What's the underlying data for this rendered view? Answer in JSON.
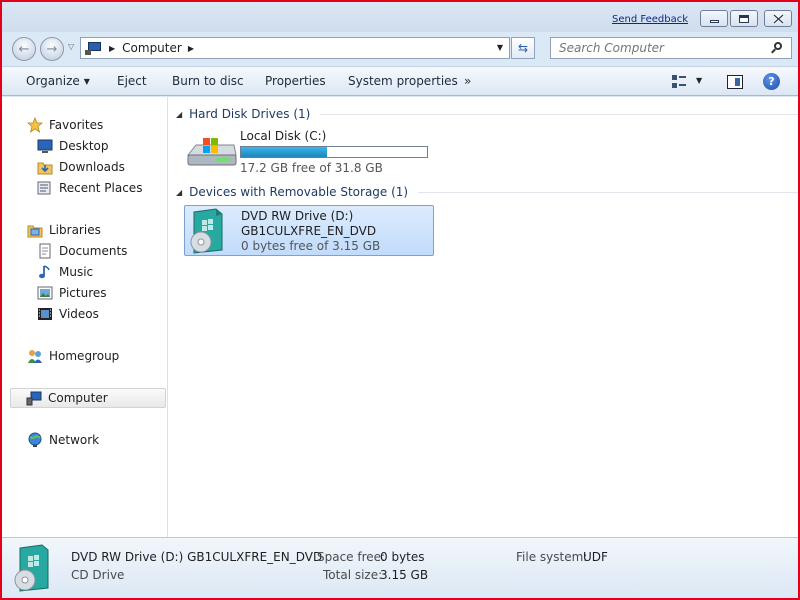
{
  "window": {
    "send_feedback": "Send Feedback"
  },
  "address": {
    "location": "Computer",
    "search_placeholder": "Search Computer"
  },
  "toolbar": {
    "organize": "Organize",
    "eject": "Eject",
    "burn": "Burn to disc",
    "properties": "Properties",
    "system_properties": "System properties",
    "more": "»"
  },
  "sidebar": {
    "favorites": {
      "label": "Favorites",
      "items": [
        "Desktop",
        "Downloads",
        "Recent Places"
      ]
    },
    "libraries": {
      "label": "Libraries",
      "items": [
        "Documents",
        "Music",
        "Pictures",
        "Videos"
      ]
    },
    "homegroup": "Homegroup",
    "computer": "Computer",
    "network": "Network"
  },
  "groups": [
    {
      "header": "Hard Disk Drives (1)",
      "drive": {
        "name": "Local Disk (C:)",
        "free_text": "17.2 GB free of 31.8 GB",
        "used_fraction": 0.46
      }
    },
    {
      "header": "Devices with Removable Storage (1)",
      "drive": {
        "name": "DVD RW Drive (D:)",
        "label": "GB1CULXFRE_EN_DVD",
        "free_text": "0 bytes free of 3.15 GB"
      }
    }
  ],
  "details": {
    "title": "DVD RW Drive (D:) GB1CULXFRE_EN_DVD",
    "type": "CD Drive",
    "space_free_label": "Space free:",
    "space_free": "0 bytes",
    "total_size_label": "Total size:",
    "total_size": "3.15 GB",
    "fs_label": "File system:",
    "fs": "UDF"
  },
  "colors": {
    "frame": "#e2001a",
    "capacity_fill": "#26a0da",
    "selection": "#c9e0fc"
  }
}
